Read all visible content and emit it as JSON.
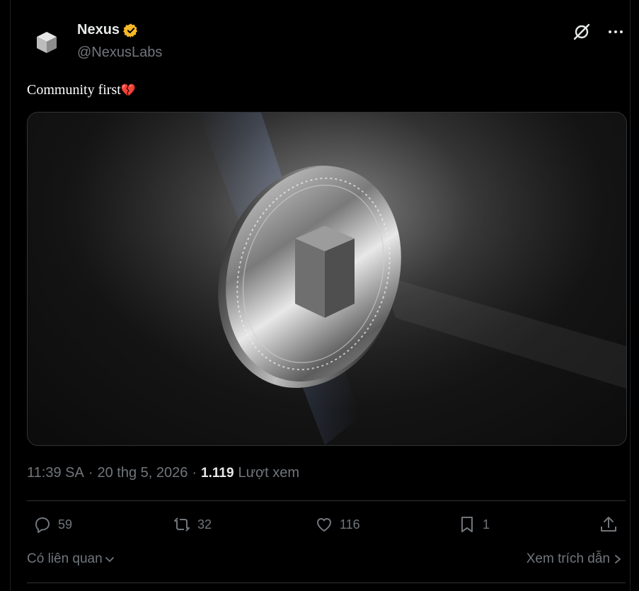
{
  "author": {
    "name": "Nexus",
    "handle": "@NexusLabs",
    "verified_color": "#f7b928"
  },
  "tweet": {
    "text": "Community first",
    "emoji": "💔",
    "media_icon": "nexus-coin-image"
  },
  "meta": {
    "time": "11:39 SA",
    "separator": "·",
    "date": "20 thg 5, 2026",
    "views": "1.119",
    "views_label": "Lượt xem"
  },
  "actions": {
    "replies": "59",
    "reposts": "32",
    "likes": "116",
    "bookmarks": "1"
  },
  "footer": {
    "related": "Có liên quan",
    "quotes": "Xem trích dẫn"
  },
  "colors": {
    "background": "#000000",
    "muted": "#71767b",
    "text": "#e7e9ea",
    "divider": "#2f3336"
  }
}
